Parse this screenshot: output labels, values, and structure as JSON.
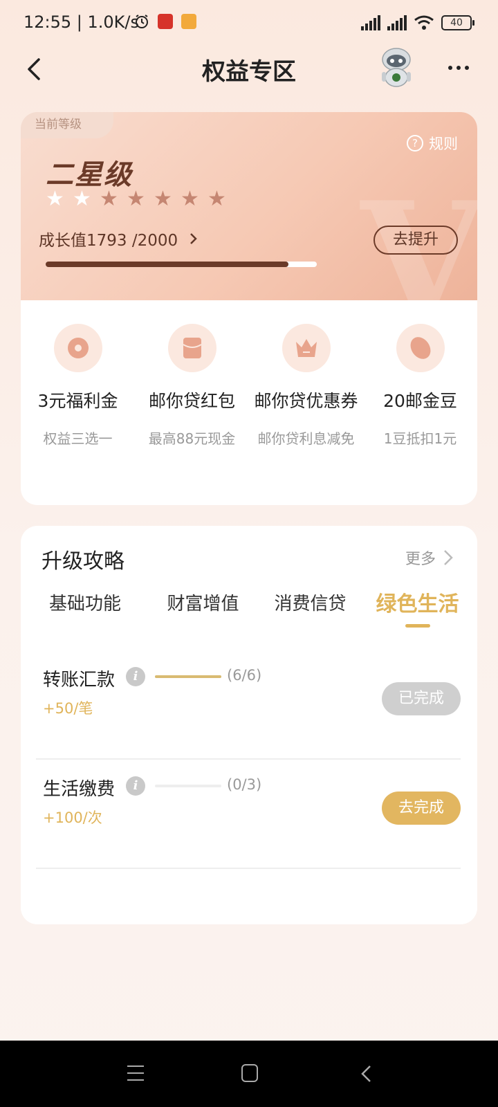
{
  "status_bar": {
    "time": "12:55 | 1.0K/s",
    "battery": "40"
  },
  "header": {
    "title": "权益专区"
  },
  "level": {
    "current_label": "当前等级",
    "rules_label": "规则",
    "name": "二星级",
    "stars_filled": 2,
    "stars_total": 7,
    "growth_text": "成长值1793 /2000",
    "growth_value": 1793,
    "growth_max": 2000,
    "upgrade_button": "去提升"
  },
  "benefits": [
    {
      "title": "3元福利金",
      "subtitle": "权益三选一",
      "icon": "coin-icon"
    },
    {
      "title": "邮你贷红包",
      "subtitle": "最高88元现金",
      "icon": "red-packet-icon"
    },
    {
      "title": "邮你贷优惠券",
      "subtitle": "邮你贷利息减免",
      "icon": "crown-coupon-icon"
    },
    {
      "title": "20邮金豆",
      "subtitle": "1豆抵扣1元",
      "icon": "bean-icon"
    }
  ],
  "strategy": {
    "title": "升级攻略",
    "more": "更多",
    "tabs": [
      "基础功能",
      "财富增值",
      "消费信贷",
      "绿色生活"
    ],
    "active_tab": 3,
    "tasks": [
      {
        "name": "转账汇款",
        "count": "(6/6)",
        "progress": 1.0,
        "reward": "+50/笔",
        "button": "已完成",
        "state": "done"
      },
      {
        "name": "生活缴费",
        "count": "(0/3)",
        "progress": 0.0,
        "reward": "+100/次",
        "button": "去完成",
        "state": "todo"
      }
    ]
  },
  "colors": {
    "accent": "#e0b45a",
    "brown": "#6b3a28",
    "done_gray": "#cfcfcf"
  }
}
